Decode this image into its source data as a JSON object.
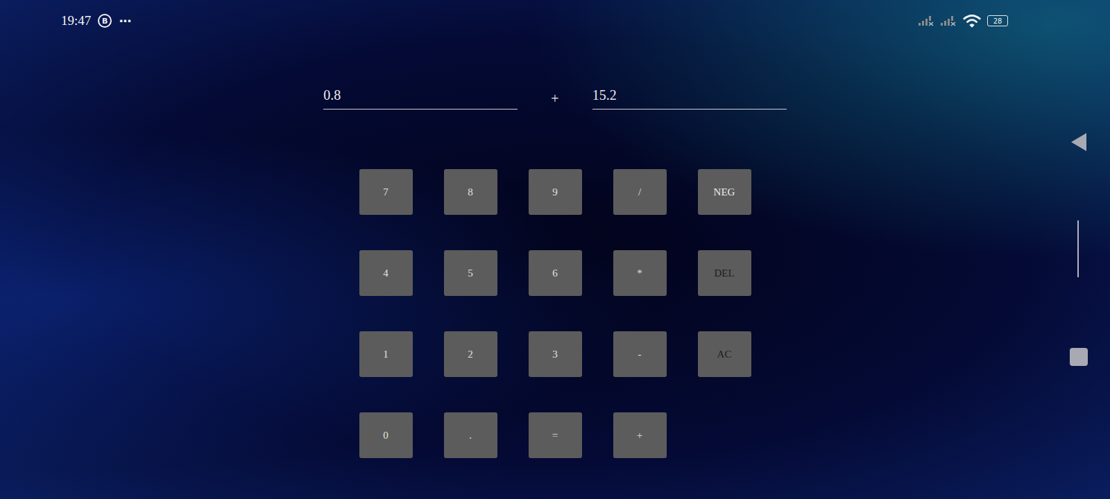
{
  "status_bar": {
    "time": "19:47",
    "notification_icons": [
      "B",
      "···"
    ],
    "battery": "28"
  },
  "expression": {
    "left": "0.8",
    "operator": "+",
    "right": "15.2"
  },
  "keypad": [
    [
      {
        "label": "7",
        "color": "#e2e2e2"
      },
      {
        "label": "8",
        "color": "#e2e2e2"
      },
      {
        "label": "9",
        "color": "#e2e2e2"
      },
      {
        "label": "/",
        "color": "#e2e2e2"
      },
      {
        "label": "NEG",
        "color": "#eeeeee"
      }
    ],
    [
      {
        "label": "4",
        "color": "#e2e2e2"
      },
      {
        "label": "5",
        "color": "#e2e2e2"
      },
      {
        "label": "6",
        "color": "#e2e2e2"
      },
      {
        "label": "*",
        "color": "#e2e2e2"
      },
      {
        "label": "DEL",
        "color": "#1c1c1c"
      }
    ],
    [
      {
        "label": "1",
        "color": "#e2e2e2"
      },
      {
        "label": "2",
        "color": "#e2e2e2"
      },
      {
        "label": "3",
        "color": "#e2e2e2"
      },
      {
        "label": "-",
        "color": "#e2e2e2"
      },
      {
        "label": "AC",
        "color": "#1c1c1c"
      }
    ],
    [
      {
        "label": "0",
        "color": "#e2e2e2"
      },
      {
        "label": ".",
        "color": "#e2e2e2"
      },
      {
        "label": "=",
        "color": "#e2e2e2"
      },
      {
        "label": "+",
        "color": "#e2e2e2"
      }
    ]
  ]
}
